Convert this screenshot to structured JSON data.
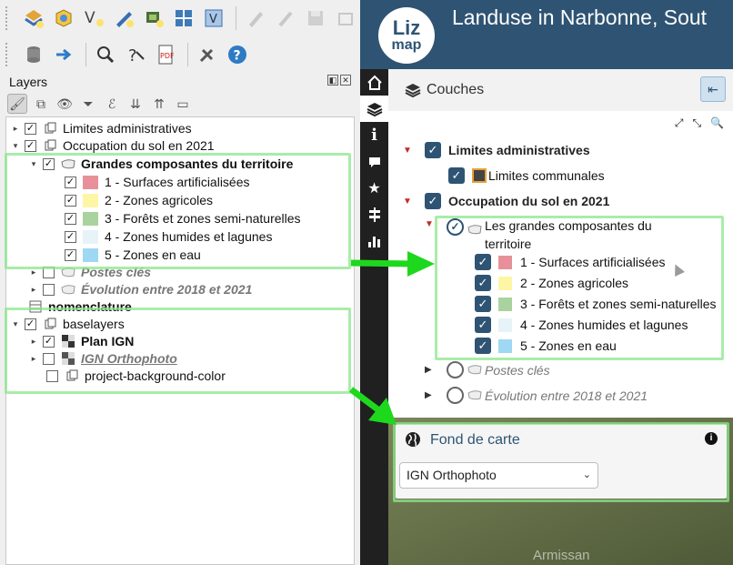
{
  "qgis": {
    "layers_panel": {
      "title": "Layers",
      "dock_buttons": [
        "◧",
        "✕"
      ]
    },
    "tree": [
      {
        "label": "Limites administratives",
        "checked": true,
        "arrow": "▸",
        "kind": "group"
      },
      {
        "label": "Occupation du sol en 2021",
        "checked": true,
        "arrow": "▾",
        "kind": "group"
      },
      {
        "label": "Grandes composantes du territoire",
        "checked": true,
        "arrow": "▾",
        "kind": "layer"
      },
      {
        "label": "1 - Surfaces artificialisées",
        "checked": true,
        "color": "#e8909a"
      },
      {
        "label": "2 - Zones agricoles",
        "checked": true,
        "color": "#fdf6a6"
      },
      {
        "label": "3 - Forêts et zones semi-naturelles",
        "checked": true,
        "color": "#a9d39e"
      },
      {
        "label": "4 - Zones humides et lagunes",
        "checked": true,
        "color": "#e6f3f8"
      },
      {
        "label": "5 - Zones en eau",
        "checked": true,
        "color": "#9fd8f2"
      },
      {
        "label": "Postes clés",
        "checked": false,
        "arrow": "▸",
        "kind": "layer"
      },
      {
        "label": "Évolution entre 2018 et 2021",
        "checked": false,
        "arrow": "▸",
        "kind": "layer"
      },
      {
        "label": "nomenclature",
        "kind": "table"
      },
      {
        "label": "baselayers",
        "checked": true,
        "arrow": "▾",
        "kind": "group"
      },
      {
        "label": "Plan IGN",
        "checked": true,
        "arrow": "▸",
        "kind": "raster"
      },
      {
        "label": "IGN Orthophoto",
        "checked": false,
        "arrow": "▸",
        "kind": "raster"
      },
      {
        "label": "project-background-color",
        "checked": false,
        "kind": "group"
      }
    ]
  },
  "lizmap": {
    "logo_line1": "Liz",
    "logo_line2": "map",
    "title": "Landuse in Narbonne, Sout",
    "menu_icons": [
      "home-icon",
      "layers-icon",
      "info-icon",
      "comment-icon",
      "star-icon",
      "signpost-icon",
      "chart-icon"
    ],
    "layers_panel": {
      "title": "Couches",
      "close_glyph": "⇤",
      "tools": [
        "⤢",
        "⤡",
        "🔍"
      ]
    },
    "tree": [
      {
        "label": "Limites administratives",
        "arrow": "▼",
        "control": "checkbox"
      },
      {
        "label": "Limites communales",
        "control": "checkbox"
      },
      {
        "label": "Occupation du sol en 2021",
        "arrow": "▼",
        "control": "checkbox"
      },
      {
        "label": "Les grandes composantes du territoire",
        "arrow": "▼",
        "control": "radio"
      },
      {
        "label": "1 - Surfaces artificialisées",
        "control": "checkbox",
        "color": "#e8909a"
      },
      {
        "label": "2 - Zones agricoles",
        "control": "checkbox",
        "color": "#fdf6a6"
      },
      {
        "label": "3 - Forêts et zones semi-naturelles",
        "control": "checkbox",
        "color": "#a9d39e"
      },
      {
        "label": "4 - Zones humides et lagunes",
        "control": "checkbox",
        "color": "#e6f3f8"
      },
      {
        "label": "5 - Zones en eau",
        "control": "checkbox",
        "color": "#9fd8f2"
      },
      {
        "label": "Postes clés",
        "arrow": "▶",
        "control": "radio-empty"
      },
      {
        "label": "Évolution entre 2018 et 2021",
        "arrow": "▶",
        "control": "radio-empty"
      }
    ],
    "basemap": {
      "title": "Fond de carte",
      "info_glyph": "i",
      "selected": "IGN Orthophoto"
    },
    "map_label": "Armissan"
  },
  "colors": {
    "lizmap_blue": "#2f5473",
    "highlight_green": "#8ce68c",
    "arrow_green": "#22d822"
  }
}
